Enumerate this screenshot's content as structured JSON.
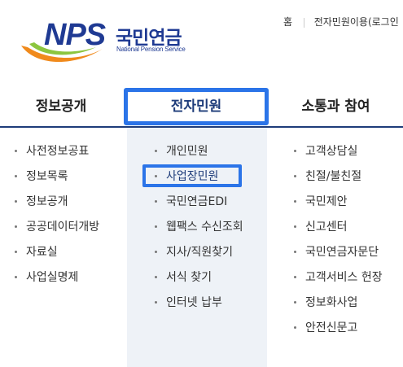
{
  "brand": {
    "logo_text": "NPS",
    "name_ko": "국민연금",
    "name_en": "National Pension Service"
  },
  "utility": {
    "home": "홈",
    "civil_login": "전자민원이용(로그인"
  },
  "gnb": {
    "tabs": [
      "정보공개",
      "전자민원",
      "소통과 참여"
    ],
    "active_tab": "전자민원"
  },
  "menus": {
    "info": [
      "사전정보공표",
      "정보목록",
      "정보공개",
      "공공데이터개방",
      "자료실",
      "사업실명제"
    ],
    "civil": [
      "개인민원",
      "사업장민원",
      "국민연금EDI",
      "웹팩스 수신조회",
      "지사/직원찾기",
      "서식 찾기",
      "인터넷 납부"
    ],
    "comm": [
      "고객상담실",
      "친절/불친절",
      "국민제안",
      "신고센터",
      "국민연금자문단",
      "고객서비스 헌장",
      "정보화사업",
      "안전신문고"
    ]
  },
  "highlighted_item": "사업장민원",
  "colors": {
    "brand_blue": "#1f3a93",
    "highlight_blue": "#2b74e8",
    "column_bg": "#eef2f7"
  }
}
